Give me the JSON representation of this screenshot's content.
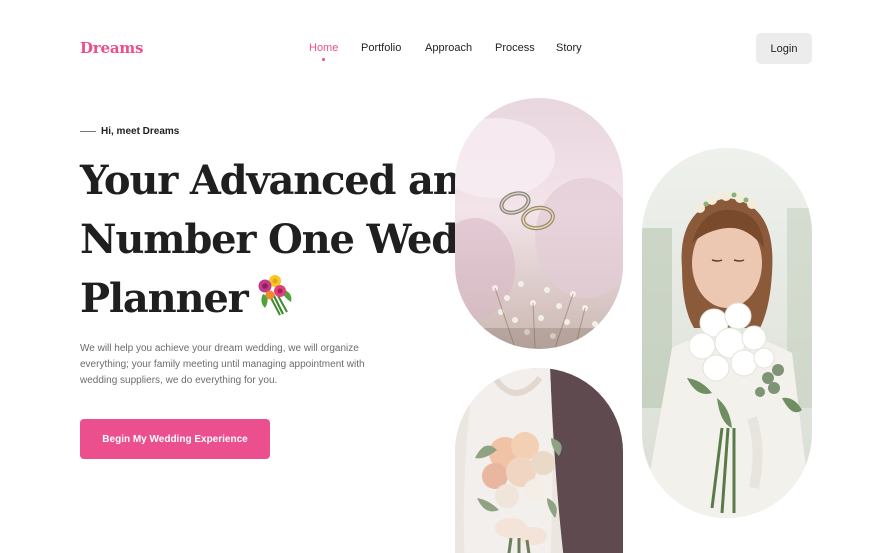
{
  "brand": {
    "name": "Dreams",
    "accent": "#ec4f8e"
  },
  "nav": {
    "items": [
      {
        "label": "Home",
        "active": true
      },
      {
        "label": "Portfolio",
        "active": false
      },
      {
        "label": "Approach",
        "active": false
      },
      {
        "label": "Process",
        "active": false
      },
      {
        "label": "Story",
        "active": false
      }
    ],
    "login_label": "Login"
  },
  "hero": {
    "eyebrow": "Hi, meet Dreams",
    "headline_line1": "Your Advanced and",
    "headline_line2": "Number One Wedding",
    "headline_line3": "Planner",
    "headline_icon": "bouquet-emoji-icon",
    "description": "We will help you achieve your dream wedding, we will organize everything; your family meeting until managing appointment with wedding suppliers, we do everything for you.",
    "cta_label": "Begin My Wedding Experience"
  },
  "gallery": [
    {
      "subject": "wedding-rings-photo"
    },
    {
      "subject": "bride-with-bouquet-photo"
    },
    {
      "subject": "couple-holding-bouquet-photo"
    }
  ]
}
